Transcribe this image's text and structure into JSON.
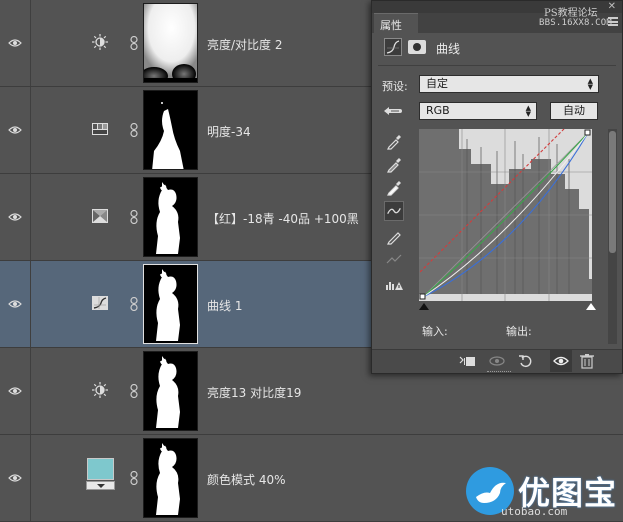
{
  "layers": [
    {
      "name": "亮度/对比度 2",
      "icon": "brightness-contrast-icon",
      "mask": "brightness-mask",
      "selected": false
    },
    {
      "name": "明度-34",
      "icon": "hue-saturation-icon",
      "mask": "silhouette-partial",
      "selected": false
    },
    {
      "name": "【红】-18青 -40品 +100黑",
      "icon": "selective-color-icon",
      "mask": "silhouette",
      "selected": false
    },
    {
      "name": "曲线 1",
      "icon": "curves-icon",
      "mask": "silhouette",
      "selected": true
    },
    {
      "name": "亮度13 对比度19",
      "icon": "brightness-contrast-icon",
      "mask": "silhouette",
      "selected": false
    },
    {
      "name": "颜色模式 40%",
      "icon": "color-fill-swatch",
      "mask": "silhouette",
      "selected": false
    }
  ],
  "swatch_color": "#7ec8cd",
  "properties": {
    "tab_label": "属性",
    "close_glyph": "✕",
    "panel_title": "曲线",
    "preset_label": "预设:",
    "preset_value": "自定",
    "channel_value": "RGB",
    "auto_label": "自动",
    "input_label": "输入:",
    "output_label": "输出:"
  },
  "watermark": {
    "site_cn": "PS教程论坛",
    "site_url": "BBS.16XX8.COM",
    "logo_text": "优图宝",
    "logo_url": "utobao.com"
  },
  "curve_colors": {
    "red": "#d23c3c",
    "green": "#3aa84a",
    "blue": "#3a6fd8",
    "composite": "#dddddd"
  }
}
